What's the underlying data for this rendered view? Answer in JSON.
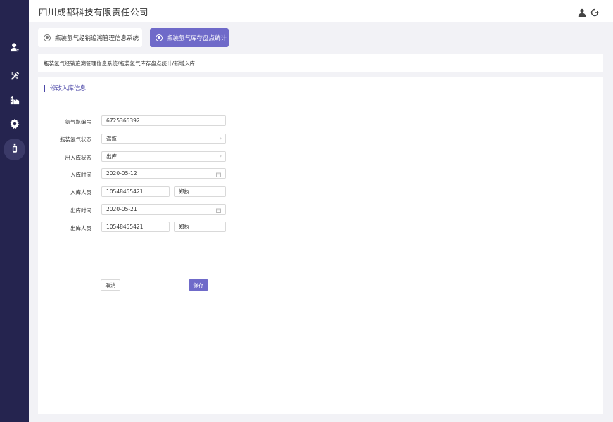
{
  "header": {
    "company_title": "四川成都科技有限责任公司"
  },
  "sidebar": {
    "items": [
      {
        "icon": "user-icon"
      },
      {
        "icon": "tools-icon"
      },
      {
        "icon": "factory-icon"
      },
      {
        "icon": "gear-icon"
      },
      {
        "icon": "cylinder-icon",
        "active": true
      }
    ]
  },
  "tabs": [
    {
      "label": "瓶装氢气经销追溯管理信息系统",
      "active": false
    },
    {
      "label": "瓶装氢气库存盘点统计",
      "active": true
    }
  ],
  "breadcrumb": "瓶装氢气经销追溯管理信息系统/瓶装氢气库存盘点统计/新增入库",
  "form": {
    "section_title": "修改入库信息",
    "cylinder_no": {
      "label": "氢气瓶编号",
      "value": "6725365392"
    },
    "cylinder_status": {
      "label": "瓶装氢气状态",
      "value": "满瓶"
    },
    "io_status": {
      "label": "出入库状态",
      "value": "出库"
    },
    "in_time": {
      "label": "入库时间",
      "value": "2020-05-12"
    },
    "in_person": {
      "label": "入库人员",
      "phone": "10548455421",
      "name": "郑执"
    },
    "out_time": {
      "label": "出库时间",
      "value": "2020-05-21"
    },
    "out_person": {
      "label": "出库人员",
      "phone": "10548455421",
      "name": "郑执"
    },
    "cancel_label": "取消",
    "save_label": "保存"
  },
  "colors": {
    "sidebar_bg": "#25244f",
    "accent": "#6f6ac9",
    "section_accent": "#4b47a8"
  }
}
